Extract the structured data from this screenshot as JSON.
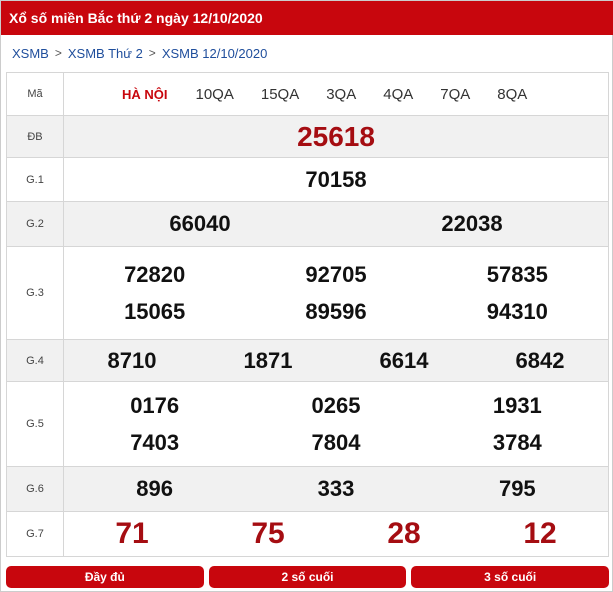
{
  "title": "Xổ số miền Bắc thứ 2 ngày 12/10/2020",
  "breadcrumb": [
    "XSMB",
    "XSMB Thứ 2",
    "XSMB 12/10/2020"
  ],
  "header": {
    "label": "Mã",
    "province": "HÀ NỘI",
    "codes": [
      "10QA",
      "15QA",
      "3QA",
      "4QA",
      "7QA",
      "8QA"
    ]
  },
  "prizes": {
    "db": {
      "label": "ĐB",
      "values": [
        "25618"
      ]
    },
    "g1": {
      "label": "G.1",
      "values": [
        "70158"
      ]
    },
    "g2": {
      "label": "G.2",
      "values": [
        "66040",
        "22038"
      ]
    },
    "g3": {
      "label": "G.3",
      "values": [
        "72820",
        "92705",
        "57835",
        "15065",
        "89596",
        "94310"
      ]
    },
    "g4": {
      "label": "G.4",
      "values": [
        "8710",
        "1871",
        "6614",
        "6842"
      ]
    },
    "g5": {
      "label": "G.5",
      "values": [
        "0176",
        "0265",
        "1931",
        "7403",
        "7804",
        "3784"
      ]
    },
    "g6": {
      "label": "G.6",
      "values": [
        "896",
        "333",
        "795"
      ]
    },
    "g7": {
      "label": "G.7",
      "values": [
        "71",
        "75",
        "28",
        "12"
      ]
    }
  },
  "buttons": [
    "Đầy đủ",
    "2 số cuối",
    "3 số cuối"
  ],
  "colors": {
    "brand_red": "#c8060d",
    "number_red": "#a50d12",
    "link_blue": "#1f4e9c"
  }
}
